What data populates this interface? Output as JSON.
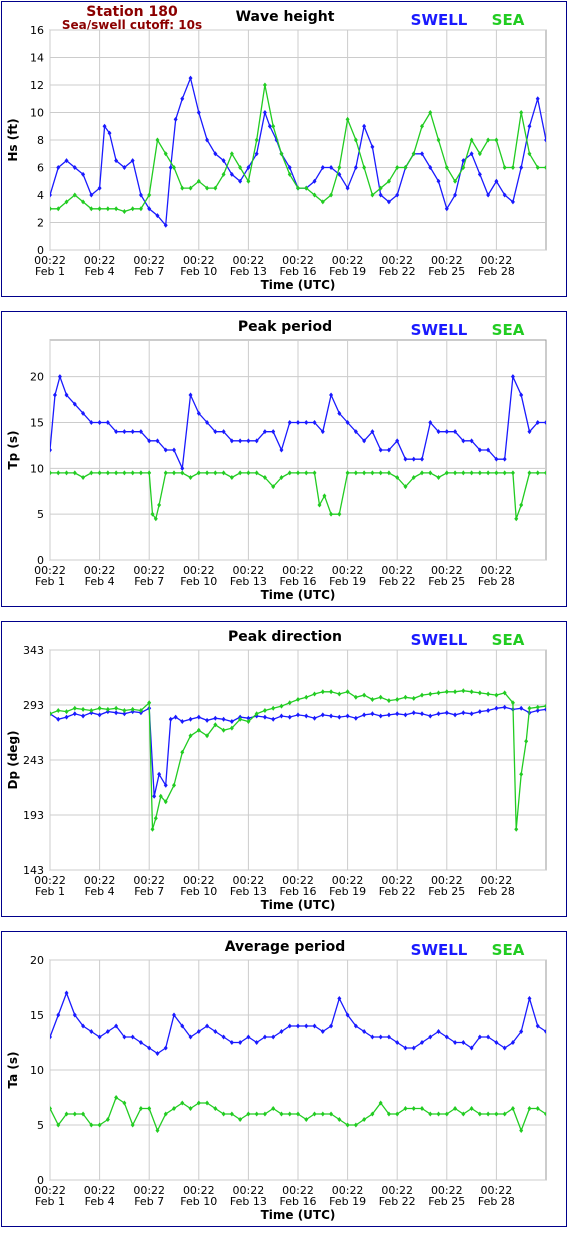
{
  "header": {
    "station": "Station 180",
    "cutoff": "Sea/swell cutoff: 10s"
  },
  "legend": {
    "swell": "SWELL",
    "sea": "SEA",
    "swell_color": "#1a1aff",
    "sea_color": "#22cc22"
  },
  "x_axis": {
    "label": "Time (UTC)",
    "ticks_time": [
      "00:22",
      "00:22",
      "00:22",
      "00:22",
      "00:22",
      "00:22",
      "00:22",
      "00:22",
      "00:22",
      "00:22"
    ],
    "ticks_date": [
      "Feb 1",
      "Feb 4",
      "Feb 7",
      "Feb 10",
      "Feb 13",
      "Feb 16",
      "Feb 19",
      "Feb 22",
      "Feb 25",
      "Feb 28"
    ],
    "range_days": [
      0,
      30
    ]
  },
  "chart_data": [
    {
      "type": "line",
      "title": "Wave height",
      "ylabel": "Hs (ft)",
      "ylim": [
        0,
        16
      ],
      "yticks": [
        0,
        2,
        4,
        6,
        8,
        10,
        12,
        14,
        16
      ],
      "grid": true,
      "series": [
        {
          "name": "SWELL",
          "color": "#1a1aff",
          "x": [
            0,
            0.5,
            1,
            1.5,
            2,
            2.5,
            3,
            3.3,
            3.6,
            4,
            4.5,
            5,
            5.5,
            6,
            6.5,
            7,
            7.3,
            7.6,
            8,
            8.5,
            9,
            9.5,
            10,
            10.5,
            11,
            11.5,
            12,
            12.5,
            13,
            13.3,
            13.7,
            14,
            14.5,
            15,
            15.5,
            16,
            16.5,
            17,
            17.5,
            18,
            18.5,
            19,
            19.5,
            20,
            20.5,
            21,
            21.5,
            22,
            22.5,
            23,
            23.5,
            24,
            24.5,
            25,
            25.5,
            26,
            26.5,
            27,
            27.5,
            28,
            28.5,
            29,
            29.5,
            30
          ],
          "y": [
            4,
            6,
            6.5,
            6,
            5.5,
            4,
            4.5,
            9,
            8.5,
            6.5,
            6,
            6.5,
            4,
            3,
            2.5,
            1.8,
            6,
            9.5,
            11,
            12.5,
            10,
            8,
            7,
            6.5,
            5.5,
            5,
            6,
            7,
            10,
            9,
            8,
            7,
            6,
            4.5,
            4.5,
            5,
            6,
            6,
            5.5,
            4.5,
            6,
            9,
            7.5,
            4,
            3.5,
            4,
            6,
            7,
            7,
            6,
            5,
            3,
            4,
            6.5,
            7,
            5.5,
            4,
            5,
            4,
            3.5,
            6,
            9,
            11,
            8
          ]
        },
        {
          "name": "SEA",
          "color": "#22cc22",
          "x": [
            0,
            0.5,
            1,
            1.5,
            2,
            2.5,
            3,
            3.5,
            4,
            4.5,
            5,
            5.5,
            6,
            6.5,
            7,
            7.5,
            8,
            8.5,
            9,
            9.5,
            10,
            10.5,
            11,
            11.5,
            12,
            12.5,
            13,
            13.5,
            14,
            14.5,
            15,
            15.5,
            16,
            16.5,
            17,
            17.5,
            18,
            18.5,
            19,
            19.5,
            20,
            20.5,
            21,
            21.5,
            22,
            22.5,
            23,
            23.5,
            24,
            24.5,
            25,
            25.5,
            26,
            26.5,
            27,
            27.5,
            28,
            28.5,
            29,
            29.5,
            30
          ],
          "y": [
            3,
            3,
            3.5,
            4,
            3.5,
            3,
            3,
            3,
            3,
            2.8,
            3,
            3,
            4,
            8,
            7,
            6,
            4.5,
            4.5,
            5,
            4.5,
            4.5,
            5.5,
            7,
            6,
            5,
            8,
            12,
            9,
            7,
            5.5,
            4.5,
            4.5,
            4,
            3.5,
            4,
            6,
            9.5,
            8,
            6,
            4,
            4.5,
            5,
            6,
            6,
            7,
            9,
            10,
            8,
            6,
            5,
            6,
            8,
            7,
            8,
            8,
            6,
            6,
            10,
            7,
            6,
            6
          ]
        }
      ]
    },
    {
      "type": "line",
      "title": "Peak period",
      "ylabel": "Tp (s)",
      "ylim": [
        0,
        24
      ],
      "yticks": [
        0,
        5,
        10,
        15,
        20
      ],
      "grid": true,
      "series": [
        {
          "name": "SWELL",
          "color": "#1a1aff",
          "x": [
            0,
            0.3,
            0.6,
            1,
            1.5,
            2,
            2.5,
            3,
            3.5,
            4,
            4.5,
            5,
            5.5,
            6,
            6.5,
            7,
            7.5,
            8,
            8.5,
            9,
            9.5,
            10,
            10.5,
            11,
            11.5,
            12,
            12.5,
            13,
            13.5,
            14,
            14.5,
            15,
            15.5,
            16,
            16.5,
            17,
            17.5,
            18,
            18.5,
            19,
            19.5,
            20,
            20.5,
            21,
            21.5,
            22,
            22.5,
            23,
            23.5,
            24,
            24.5,
            25,
            25.5,
            26,
            26.5,
            27,
            27.5,
            28,
            28.5,
            29,
            29.5,
            30
          ],
          "y": [
            12,
            18,
            20,
            18,
            17,
            16,
            15,
            15,
            15,
            14,
            14,
            14,
            14,
            13,
            13,
            12,
            12,
            10,
            18,
            16,
            15,
            14,
            14,
            13,
            13,
            13,
            13,
            14,
            14,
            12,
            15,
            15,
            15,
            15,
            14,
            18,
            16,
            15,
            14,
            13,
            14,
            12,
            12,
            13,
            11,
            11,
            11,
            15,
            14,
            14,
            14,
            13,
            13,
            12,
            12,
            11,
            11,
            20,
            18,
            14,
            15,
            15
          ]
        },
        {
          "name": "SEA",
          "color": "#22cc22",
          "x": [
            0,
            0.5,
            1,
            1.5,
            2,
            2.5,
            3,
            3.5,
            4,
            4.5,
            5,
            5.5,
            6,
            6.2,
            6.4,
            6.6,
            7,
            7.5,
            8,
            8.5,
            9,
            9.5,
            10,
            10.5,
            11,
            11.5,
            12,
            12.5,
            13,
            13.5,
            14,
            14.5,
            15,
            15.5,
            16,
            16.3,
            16.6,
            17,
            17.5,
            18,
            18.5,
            19,
            19.5,
            20,
            20.5,
            21,
            21.5,
            22,
            22.5,
            23,
            23.5,
            24,
            24.5,
            25,
            25.5,
            26,
            26.5,
            27,
            27.5,
            28,
            28.2,
            28.5,
            29,
            29.5,
            30
          ],
          "y": [
            9.5,
            9.5,
            9.5,
            9.5,
            9,
            9.5,
            9.5,
            9.5,
            9.5,
            9.5,
            9.5,
            9.5,
            9.5,
            5,
            4.5,
            6,
            9.5,
            9.5,
            9.5,
            9,
            9.5,
            9.5,
            9.5,
            9.5,
            9,
            9.5,
            9.5,
            9.5,
            9,
            8,
            9,
            9.5,
            9.5,
            9.5,
            9.5,
            6,
            7,
            5,
            5,
            9.5,
            9.5,
            9.5,
            9.5,
            9.5,
            9.5,
            9,
            8,
            9,
            9.5,
            9.5,
            9,
            9.5,
            9.5,
            9.5,
            9.5,
            9.5,
            9.5,
            9.5,
            9.5,
            9.5,
            4.5,
            6,
            9.5,
            9.5,
            9.5
          ]
        }
      ]
    },
    {
      "type": "line",
      "title": "Peak direction",
      "ylabel": "Dp (deg)",
      "ylim": [
        143,
        343
      ],
      "yticks": [
        143,
        193,
        243,
        293,
        343
      ],
      "grid": true,
      "series": [
        {
          "name": "SWELL",
          "color": "#1a1aff",
          "x": [
            0,
            0.5,
            1,
            1.5,
            2,
            2.5,
            3,
            3.5,
            4,
            4.5,
            5,
            5.5,
            6,
            6.3,
            6.6,
            7,
            7.3,
            7.6,
            8,
            8.5,
            9,
            9.5,
            10,
            10.5,
            11,
            11.5,
            12,
            12.5,
            13,
            13.5,
            14,
            14.5,
            15,
            15.5,
            16,
            16.5,
            17,
            17.5,
            18,
            18.5,
            19,
            19.5,
            20,
            20.5,
            21,
            21.5,
            22,
            22.5,
            23,
            23.5,
            24,
            24.5,
            25,
            25.5,
            26,
            26.5,
            27,
            27.5,
            28,
            28.5,
            29,
            29.5,
            30
          ],
          "y": [
            285,
            280,
            282,
            285,
            283,
            286,
            284,
            287,
            286,
            285,
            287,
            286,
            290,
            210,
            230,
            220,
            280,
            282,
            278,
            280,
            282,
            279,
            281,
            280,
            278,
            282,
            281,
            283,
            282,
            280,
            283,
            282,
            284,
            283,
            281,
            284,
            283,
            282,
            283,
            281,
            284,
            285,
            283,
            284,
            285,
            284,
            286,
            285,
            283,
            285,
            286,
            284,
            286,
            285,
            287,
            288,
            290,
            291,
            289,
            290,
            286,
            288,
            289
          ]
        },
        {
          "name": "SEA",
          "color": "#22cc22",
          "x": [
            0,
            0.5,
            1,
            1.5,
            2,
            2.5,
            3,
            3.5,
            4,
            4.5,
            5,
            5.5,
            6,
            6.2,
            6.4,
            6.7,
            7,
            7.5,
            8,
            8.5,
            9,
            9.5,
            10,
            10.5,
            11,
            11.5,
            12,
            12.5,
            13,
            13.5,
            14,
            14.5,
            15,
            15.5,
            16,
            16.5,
            17,
            17.5,
            18,
            18.5,
            19,
            19.5,
            20,
            20.5,
            21,
            21.5,
            22,
            22.5,
            23,
            23.5,
            24,
            24.5,
            25,
            25.5,
            26,
            26.5,
            27,
            27.5,
            28,
            28.2,
            28.5,
            28.8,
            29,
            29.5,
            30
          ],
          "y": [
            285,
            288,
            287,
            290,
            289,
            288,
            290,
            289,
            290,
            288,
            289,
            288,
            295,
            180,
            190,
            210,
            205,
            220,
            250,
            265,
            270,
            265,
            275,
            270,
            272,
            280,
            278,
            285,
            288,
            290,
            292,
            295,
            298,
            300,
            303,
            305,
            305,
            303,
            305,
            300,
            302,
            298,
            300,
            297,
            298,
            300,
            299,
            302,
            303,
            304,
            305,
            305,
            306,
            305,
            304,
            303,
            302,
            304,
            295,
            180,
            230,
            260,
            290,
            291,
            292
          ]
        }
      ]
    },
    {
      "type": "line",
      "title": "Average period",
      "ylabel": "Ta (s)",
      "ylim": [
        0,
        20
      ],
      "yticks": [
        0,
        5,
        10,
        15,
        20
      ],
      "grid": true,
      "series": [
        {
          "name": "SWELL",
          "color": "#1a1aff",
          "x": [
            0,
            0.5,
            1,
            1.5,
            2,
            2.5,
            3,
            3.5,
            4,
            4.5,
            5,
            5.5,
            6,
            6.5,
            7,
            7.5,
            8,
            8.5,
            9,
            9.5,
            10,
            10.5,
            11,
            11.5,
            12,
            12.5,
            13,
            13.5,
            14,
            14.5,
            15,
            15.5,
            16,
            16.5,
            17,
            17.5,
            18,
            18.5,
            19,
            19.5,
            20,
            20.5,
            21,
            21.5,
            22,
            22.5,
            23,
            23.5,
            24,
            24.5,
            25,
            25.5,
            26,
            26.5,
            27,
            27.5,
            28,
            28.5,
            29,
            29.5,
            30
          ],
          "y": [
            13,
            15,
            17,
            15,
            14,
            13.5,
            13,
            13.5,
            14,
            13,
            13,
            12.5,
            12,
            11.5,
            12,
            15,
            14,
            13,
            13.5,
            14,
            13.5,
            13,
            12.5,
            12.5,
            13,
            12.5,
            13,
            13,
            13.5,
            14,
            14,
            14,
            14,
            13.5,
            14,
            16.5,
            15,
            14,
            13.5,
            13,
            13,
            13,
            12.5,
            12,
            12,
            12.5,
            13,
            13.5,
            13,
            12.5,
            12.5,
            12,
            13,
            13,
            12.5,
            12,
            12.5,
            13.5,
            16.5,
            14,
            13.5
          ]
        },
        {
          "name": "SEA",
          "color": "#22cc22",
          "x": [
            0,
            0.5,
            1,
            1.5,
            2,
            2.5,
            3,
            3.5,
            4,
            4.5,
            5,
            5.5,
            6,
            6.5,
            7,
            7.5,
            8,
            8.5,
            9,
            9.5,
            10,
            10.5,
            11,
            11.5,
            12,
            12.5,
            13,
            13.5,
            14,
            14.5,
            15,
            15.5,
            16,
            16.5,
            17,
            17.5,
            18,
            18.5,
            19,
            19.5,
            20,
            20.5,
            21,
            21.5,
            22,
            22.5,
            23,
            23.5,
            24,
            24.5,
            25,
            25.5,
            26,
            26.5,
            27,
            27.5,
            28,
            28.5,
            29,
            29.5,
            30
          ],
          "y": [
            6.5,
            5,
            6,
            6,
            6,
            5,
            5,
            5.5,
            7.5,
            7,
            5,
            6.5,
            6.5,
            4.5,
            6,
            6.5,
            7,
            6.5,
            7,
            7,
            6.5,
            6,
            6,
            5.5,
            6,
            6,
            6,
            6.5,
            6,
            6,
            6,
            5.5,
            6,
            6,
            6,
            5.5,
            5,
            5,
            5.5,
            6,
            7,
            6,
            6,
            6.5,
            6.5,
            6.5,
            6,
            6,
            6,
            6.5,
            6,
            6.5,
            6,
            6,
            6,
            6,
            6.5,
            4.5,
            6.5,
            6.5,
            6
          ]
        }
      ]
    }
  ]
}
